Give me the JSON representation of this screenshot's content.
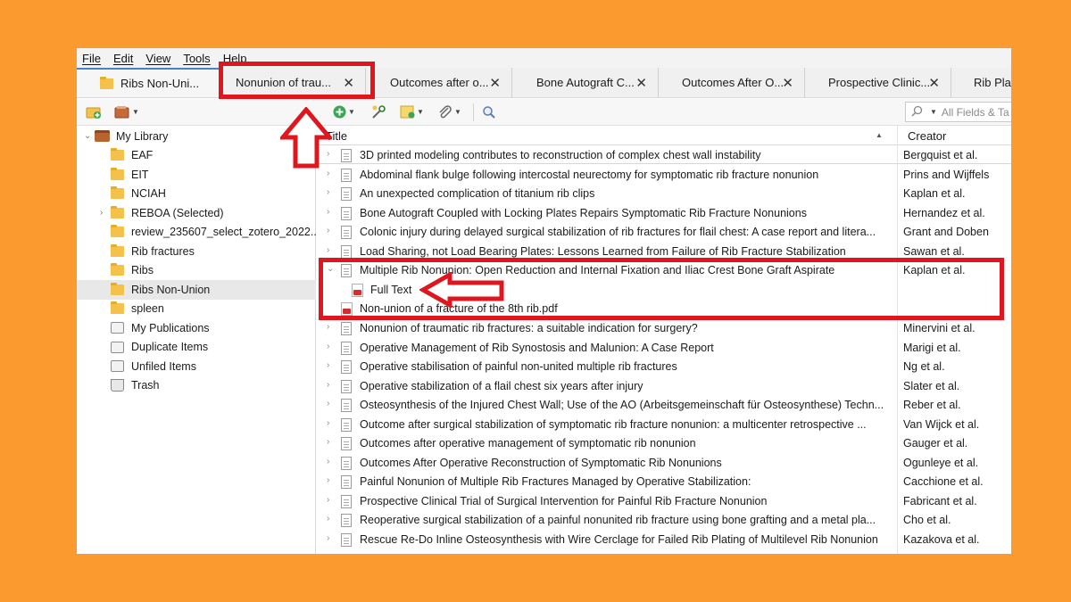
{
  "menu": [
    "File",
    "Edit",
    "View",
    "Tools",
    "Help"
  ],
  "tabs": [
    {
      "label": "Ribs Non-Uni..."
    },
    {
      "label": "Nonunion of trau..."
    },
    {
      "label": "Outcomes after o..."
    },
    {
      "label": "Bone Autograft C..."
    },
    {
      "label": "Outcomes After O..."
    },
    {
      "label": "Prospective Clinic..."
    },
    {
      "label": "Rib Plat"
    }
  ],
  "search": {
    "placeholder": "All Fields & Ta"
  },
  "sidebar": {
    "root": "My Library",
    "items": [
      {
        "label": "EAF"
      },
      {
        "label": "EIT"
      },
      {
        "label": "NCIAH"
      },
      {
        "label": "REBOA (Selected)"
      },
      {
        "label": "review_235607_select_zotero_2022..."
      },
      {
        "label": "Rib fractures"
      },
      {
        "label": "Ribs"
      },
      {
        "label": "Ribs Non-Union"
      },
      {
        "label": "spleen"
      },
      {
        "label": "My Publications"
      },
      {
        "label": "Duplicate Items"
      },
      {
        "label": "Unfiled Items"
      },
      {
        "label": "Trash"
      }
    ]
  },
  "columns": {
    "title": "Title",
    "creator": "Creator"
  },
  "rows": [
    {
      "title": "3D printed modeling contributes to reconstruction of complex chest wall instability",
      "creator": "Bergquist et al."
    },
    {
      "title": "Abdominal flank bulge following intercostal neurectomy for symptomatic rib fracture nonunion",
      "creator": "Prins and Wijffels"
    },
    {
      "title": "An unexpected complication of titanium rib clips",
      "creator": "Kaplan et al."
    },
    {
      "title": "Bone Autograft Coupled with Locking Plates Repairs Symptomatic Rib Fracture Nonunions",
      "creator": "Hernandez et al."
    },
    {
      "title": "Colonic injury during delayed surgical stabilization of rib fractures for flail chest: A case report and litera...",
      "creator": "Grant and Doben"
    },
    {
      "title": "Load Sharing, not Load Bearing Plates: Lessons Learned from Failure of Rib Fracture Stabilization",
      "creator": "Sawan et al."
    },
    {
      "title": "Multiple Rib Nonunion: Open Reduction and Internal Fixation and Iliac Crest Bone Graft Aspirate",
      "creator": "Kaplan et al."
    },
    {
      "title": "Full Text",
      "creator": ""
    },
    {
      "title": "Non-union of a fracture of the 8th rib.pdf",
      "creator": ""
    },
    {
      "title": "Nonunion of traumatic rib fractures: a suitable indication for surgery?",
      "creator": "Minervini et al."
    },
    {
      "title": "Operative Management of Rib Synostosis and Malunion: A Case Report",
      "creator": "Marigi et al."
    },
    {
      "title": "Operative stabilisation of painful non-united multiple rib fractures",
      "creator": "Ng et al."
    },
    {
      "title": "Operative stabilization of a flail chest six years after injury",
      "creator": "Slater et al."
    },
    {
      "title": "Osteosynthesis of the Injured Chest Wall; Use of the AO (Arbeitsgemeinschaft für Osteosynthese) Techn...",
      "creator": "Reber et al."
    },
    {
      "title": "Outcome after surgical stabilization of symptomatic rib fracture nonunion: a multicenter retrospective ...",
      "creator": "Van Wijck et al."
    },
    {
      "title": "Outcomes after operative management of symptomatic rib nonunion",
      "creator": "Gauger et al."
    },
    {
      "title": "Outcomes After Operative Reconstruction of Symptomatic Rib Nonunions",
      "creator": "Ogunleye et al."
    },
    {
      "title": "Painful Nonunion of Multiple Rib Fractures Managed by Operative Stabilization:",
      "creator": "Cacchione et al."
    },
    {
      "title": "Prospective Clinical Trial of Surgical Intervention for Painful Rib Fracture Nonunion",
      "creator": "Fabricant et al."
    },
    {
      "title": "Reoperative surgical stabilization of a painful nonunited rib fracture using bone grafting and a metal pla...",
      "creator": "Cho et al."
    },
    {
      "title": "Rescue Re-Do Inline Osteosynthesis with Wire Cerclage for Failed Rib Plating of Multilevel Rib Nonunion",
      "creator": "Kazakova et al."
    }
  ],
  "colors": {
    "background": "#fb9a2e",
    "highlight": "#e0161e"
  }
}
